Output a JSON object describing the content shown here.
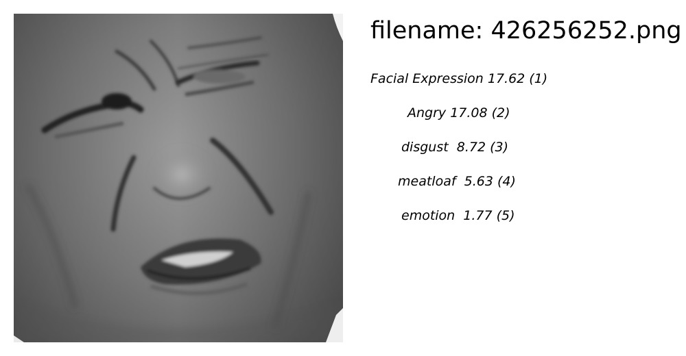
{
  "filename_label": "filename: 426256252.png",
  "image_description": "grayscale-face-photo",
  "labels": [
    {
      "text": "Facial Expression 17.62 (1)"
    },
    {
      "text": "Angry 17.08 (2)"
    },
    {
      "text": "disgust  8.72 (3)"
    },
    {
      "text": "meatloaf  5.63 (4)"
    },
    {
      "text": "emotion  1.77 (5)"
    }
  ]
}
